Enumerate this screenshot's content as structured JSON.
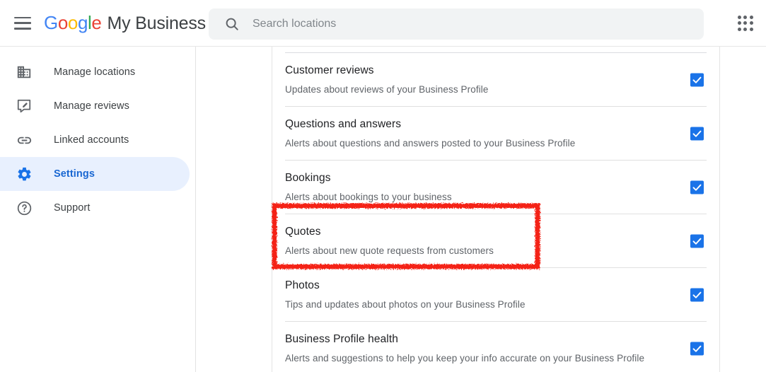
{
  "header": {
    "menu_icon": "hamburger-menu-icon",
    "brand_google": "Google",
    "brand_suffix": "My Business",
    "brand_letters": [
      {
        "ch": "G",
        "color": "#4285f4"
      },
      {
        "ch": "o",
        "color": "#ea4335"
      },
      {
        "ch": "o",
        "color": "#fbbc05"
      },
      {
        "ch": "g",
        "color": "#4285f4"
      },
      {
        "ch": "l",
        "color": "#34a853"
      },
      {
        "ch": "e",
        "color": "#ea4335"
      }
    ],
    "search": {
      "icon": "search-icon",
      "placeholder": "Search locations",
      "value": ""
    },
    "apps_icon": "apps-grid-icon"
  },
  "sidebar": {
    "items": [
      {
        "label": "Manage locations",
        "icon": "building-icon",
        "active": false
      },
      {
        "label": "Manage reviews",
        "icon": "rate-review-icon",
        "active": false
      },
      {
        "label": "Linked accounts",
        "icon": "link-icon",
        "active": false
      },
      {
        "label": "Settings",
        "icon": "gear-icon",
        "active": true
      },
      {
        "label": "Support",
        "icon": "help-circle-icon",
        "active": false
      }
    ]
  },
  "main": {
    "rows": [
      {
        "title": "Customer reviews",
        "description": "Updates about reviews of your Business Profile",
        "checked": true
      },
      {
        "title": "Questions and answers",
        "description": "Alerts about questions and answers posted to your Business Profile",
        "checked": true
      },
      {
        "title": "Bookings",
        "description": "Alerts about bookings to your business",
        "checked": true
      },
      {
        "title": "Quotes",
        "description": "Alerts about new quote requests from customers",
        "checked": true
      },
      {
        "title": "Photos",
        "description": "Tips and updates about photos on your Business Profile",
        "checked": true
      },
      {
        "title": "Business Profile health",
        "description": "Alerts and suggestions to help you keep your info accurate on your Business Profile",
        "checked": true
      }
    ]
  },
  "annotation": {
    "target_row_title": "Quotes",
    "color": "#f42314",
    "shape": "rough-rectangle-highlight"
  },
  "colors": {
    "accent_blue": "#1a73e8",
    "active_pill": "#e8f0fe",
    "text_primary": "#202124",
    "text_secondary": "#5f6368",
    "search_bg": "#f1f3f4",
    "divider": "#e0e0e0"
  }
}
